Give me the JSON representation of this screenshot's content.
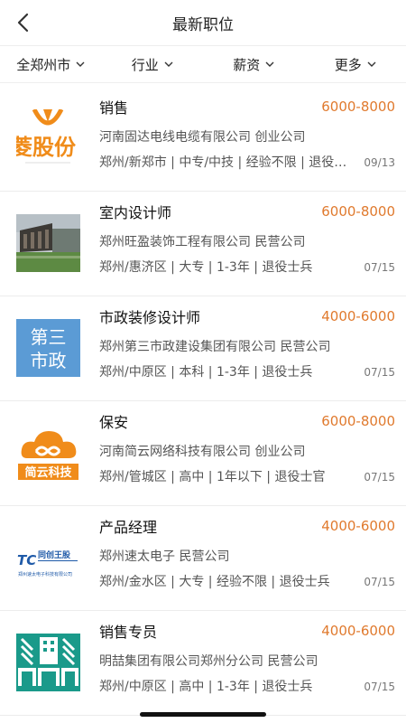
{
  "header": {
    "title": "最新职位"
  },
  "filters": [
    {
      "label": "全郑州市"
    },
    {
      "label": "行业"
    },
    {
      "label": "薪资"
    },
    {
      "label": "更多"
    }
  ],
  "jobs": [
    {
      "title": "销售",
      "salary": "6000-8000",
      "company": "河南固达电线电缆有限公司 创业公司",
      "meta": "郑州/新郑市 | 中专/中技 | 经验不限 | 退役士兵",
      "date": "09/13",
      "logo_text": "菱股份",
      "logo": "company-logo-orange-icon"
    },
    {
      "title": "室内设计师",
      "salary": "6000-8000",
      "company": "郑州旺盈装饰工程有限公司 民营公司",
      "meta": "郑州/惠济区 | 大专 | 1-3年 | 退役士兵",
      "date": "07/15",
      "logo": "building-photo-icon"
    },
    {
      "title": "市政装修设计师",
      "salary": "4000-6000",
      "company": "郑州第三市政建设集团有限公司 民营公司",
      "meta": "郑州/中原区 | 本科 | 1-3年 | 退役士兵",
      "date": "07/15",
      "logo_text_1": "第三",
      "logo_text_2": "市政",
      "logo": "text-logo-icon"
    },
    {
      "title": "保安",
      "salary": "6000-8000",
      "company": "河南简云网络科技有限公司 创业公司",
      "meta": "郑州/管城区 | 高中 | 1年以下 | 退役士官",
      "date": "07/15",
      "logo_text": "简云科技",
      "logo": "cloud-logo-icon"
    },
    {
      "title": "产品经理",
      "salary": "4000-6000",
      "company": "郑州速太电子 民营公司",
      "meta": "郑州/金水区 | 大专 | 经验不限 | 退役士兵",
      "date": "07/15",
      "logo_text": "同创王股",
      "logo_subtext": "郑州速太电子科技有限公司",
      "logo": "tc-logo-icon"
    },
    {
      "title": "销售专员",
      "salary": "4000-6000",
      "company": "明喆集团有限公司郑州分公司 民营公司",
      "meta": "郑州/中原区 | 高中 | 1-3年 | 退役士兵",
      "date": "07/15",
      "logo": "building-logo-teal-icon"
    }
  ],
  "colors": {
    "salary": "#e07a2e",
    "accent_teal": "#1a9a8a",
    "accent_blue": "#5b9bd5"
  }
}
